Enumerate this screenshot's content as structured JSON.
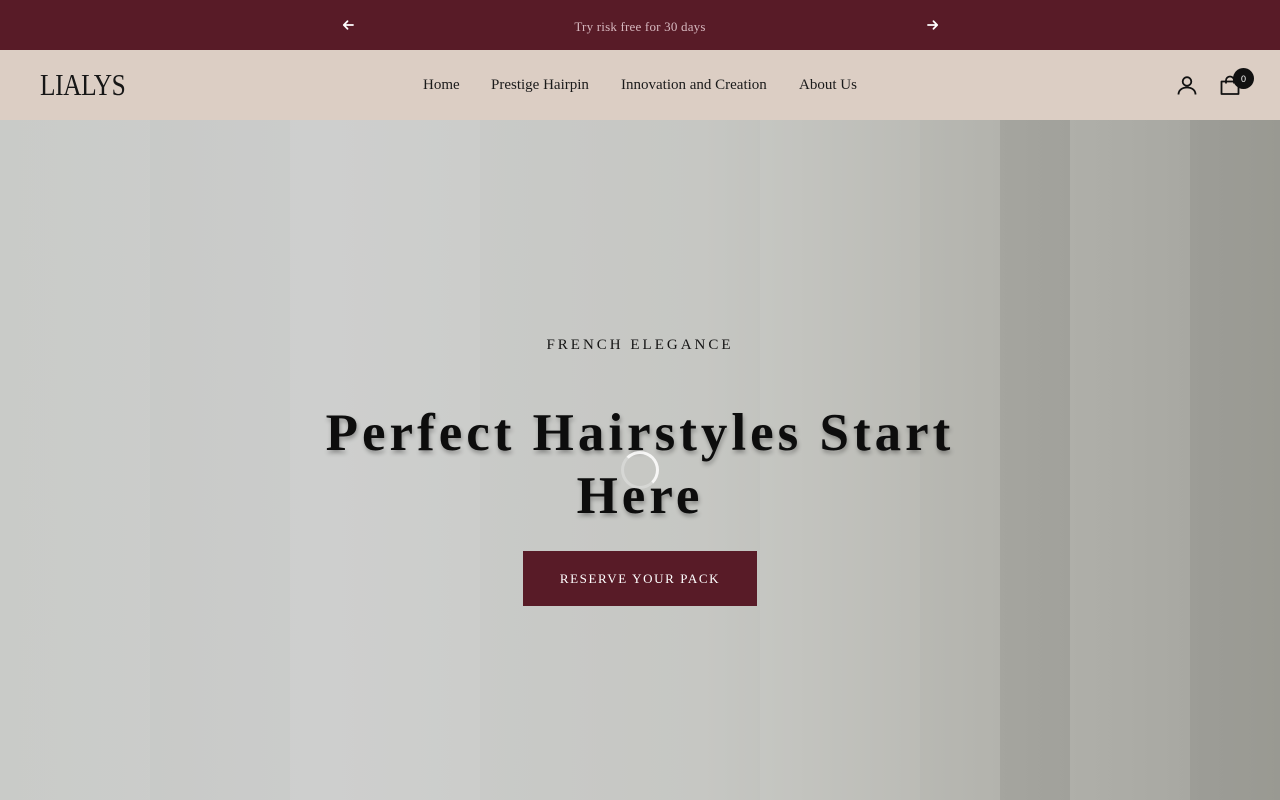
{
  "announcement_bar": {
    "message": "Try risk free for 30 days",
    "prev_icon": "arrow-left-icon",
    "next_icon": "arrow-right-icon",
    "background": "#581b27"
  },
  "header": {
    "logo_text": "LIALYS",
    "nav": [
      {
        "label": "Home"
      },
      {
        "label": "Prestige Hairpin"
      },
      {
        "label": "Innovation and Creation"
      },
      {
        "label": "About Us"
      }
    ],
    "account_icon": "user-icon",
    "cart_icon": "shopping-bag-icon",
    "cart_count": "0",
    "background": "#dccec4"
  },
  "hero": {
    "eyebrow": "FRENCH ELEGANCE",
    "headline": "Perfect Hairstyles Start Here",
    "cta_label": "RESERVE YOUR PACK",
    "cta_color": "#581b27",
    "loading_icon": "loading-spinner-icon"
  }
}
